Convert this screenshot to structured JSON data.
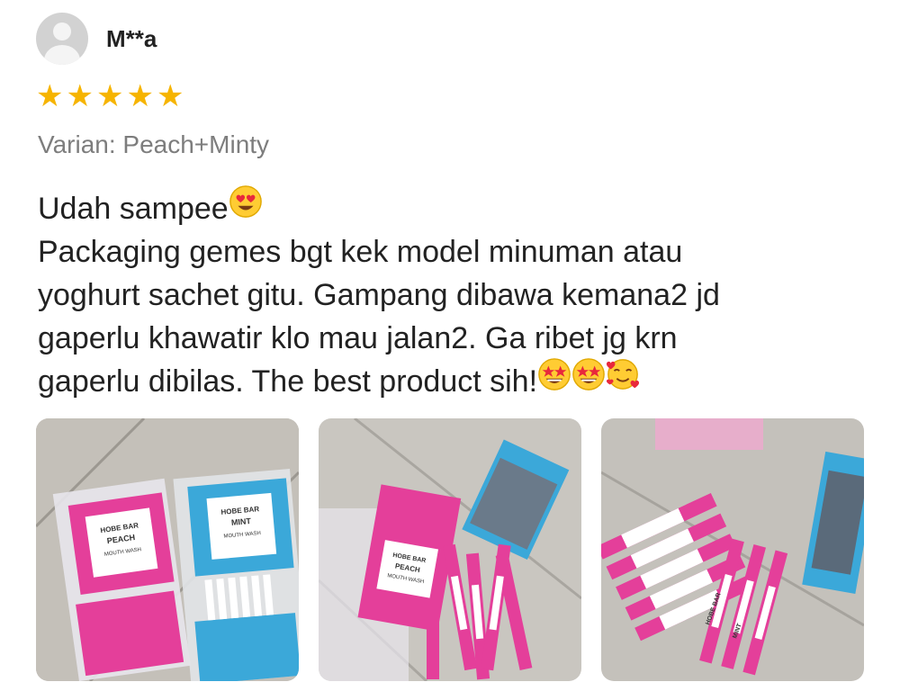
{
  "review": {
    "user": {
      "name": "M**a",
      "avatar_icon": "default-user-avatar-icon"
    },
    "rating": {
      "value": 5,
      "max": 5,
      "color": "#f6b400"
    },
    "variant": "Varian: Peach+Minty",
    "text_lines": [
      "Udah sampee",
      "Packaging gemes bgt kek model minuman atau",
      "yoghurt sachet gitu. Gampang dibawa kemana2 jd",
      "gaperlu khawatir klo mau jalan2. Ga ribet jg krn",
      "gaperlu dibilas. The best product sih!"
    ],
    "photos": [
      {
        "name": "photo-1",
        "labels": {
          "peach": [
            "HOBE BAR",
            "PEACH",
            "MOUTH WASH"
          ],
          "mint": [
            "HOBE BAR",
            "MINT",
            "MOUTH WASH"
          ]
        }
      },
      {
        "name": "photo-2",
        "labels": {
          "peach": [
            "HOBE BAR",
            "PEACH",
            "MOUTH WASH"
          ]
        }
      },
      {
        "name": "photo-3",
        "labels": {
          "peach": [
            "HOBE BAR",
            "MINT"
          ]
        }
      }
    ]
  }
}
